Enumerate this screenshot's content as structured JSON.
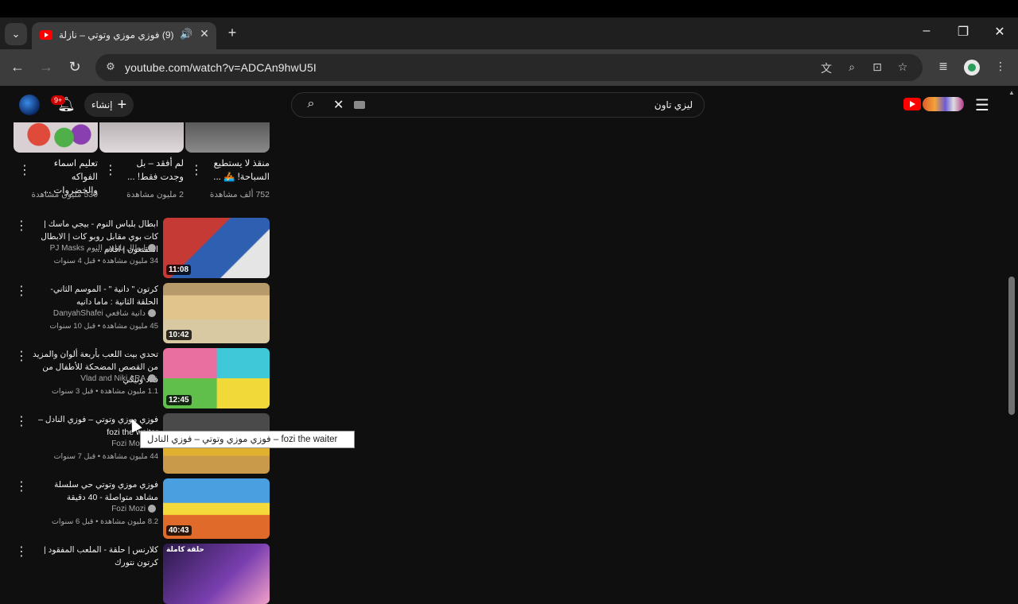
{
  "browser": {
    "tab_title": "(9) فوزي موزي وتوتي – نازلة",
    "url": "youtube.com/watch?v=ADCAn9hwU5I"
  },
  "masthead": {
    "create_label": "إنشاء",
    "notification_badge": "9+",
    "search_query": "ليزي تاون"
  },
  "shorts": [
    {
      "title": "منقذ لا يستطيع السباحة! 🚣‍ ...",
      "views": "752 ألف مشاهدة",
      "color": "#6a6a6a"
    },
    {
      "title": "لم أفقد – بل وجدت فقط! ...",
      "views": "2 مليون مشاهدة",
      "color": "#c9c2c4"
    },
    {
      "title": "تعليم اسماء الفواكه والخضروات ...",
      "views": "530 مليون مشاهدة",
      "color": "#d8cfd1"
    }
  ],
  "videos": [
    {
      "title": "ابطال بلباس النوم - بيجي ماسك | كات بوي مقابل روبو كات | الابطال المقنعون | افلام ...",
      "channel": "ابطال بلباس النوم PJ Masks",
      "meta": "34 مليون مشاهدة • قبل 4 سنوات",
      "duration": "11:08",
      "thumb_color": "#c63a36"
    },
    {
      "title": "كرتون \" دانية \" - الموسم الثاني- الحلقة الثانية : ماما دانيه",
      "channel": "دانية شافعي DanyahShafei",
      "meta": "45 مليون مشاهدة • قبل 10 سنوات",
      "duration": "10:42",
      "thumb_color": "#d7b982"
    },
    {
      "title": "تحدي بيت اللعب بأربعة ألوان والمزيد من القصص المضحكة للأطفال من فلاد ونيكي",
      "channel": "Vlad and Niki ARA",
      "meta": "1.1 مليون مشاهدة • قبل 3 سنوات",
      "duration": "12:45",
      "thumb_color": "#e86fa0"
    },
    {
      "title": "فوزي موزي وتوتي – فوزي النادل – fozi the waiter",
      "channel": "Fozi Mozi",
      "meta": "44 مليون مشاهدة • قبل 7 سنوات",
      "duration": "",
      "thumb_color": "#e0b02f"
    },
    {
      "title": "فوزي موزي وتوتي حي سلسلة مشاهد متواصلة - 40 دقيقة",
      "channel": "Fozi Mozi",
      "meta": "8.2 مليون مشاهدة • قبل 6 سنوات",
      "duration": "40:43",
      "thumb_color": "#4a9fe0"
    },
    {
      "title": "كلارنس | حلقة - الملعب المفقود | كرتون نتورك",
      "channel": "",
      "meta": "",
      "duration": "",
      "thumb_color": "#7a3fb0",
      "badge": "حلقة كاملة"
    }
  ],
  "tooltip": "فوزي موزي وتوتي – فوزي النادل  –  fozi the waiter"
}
